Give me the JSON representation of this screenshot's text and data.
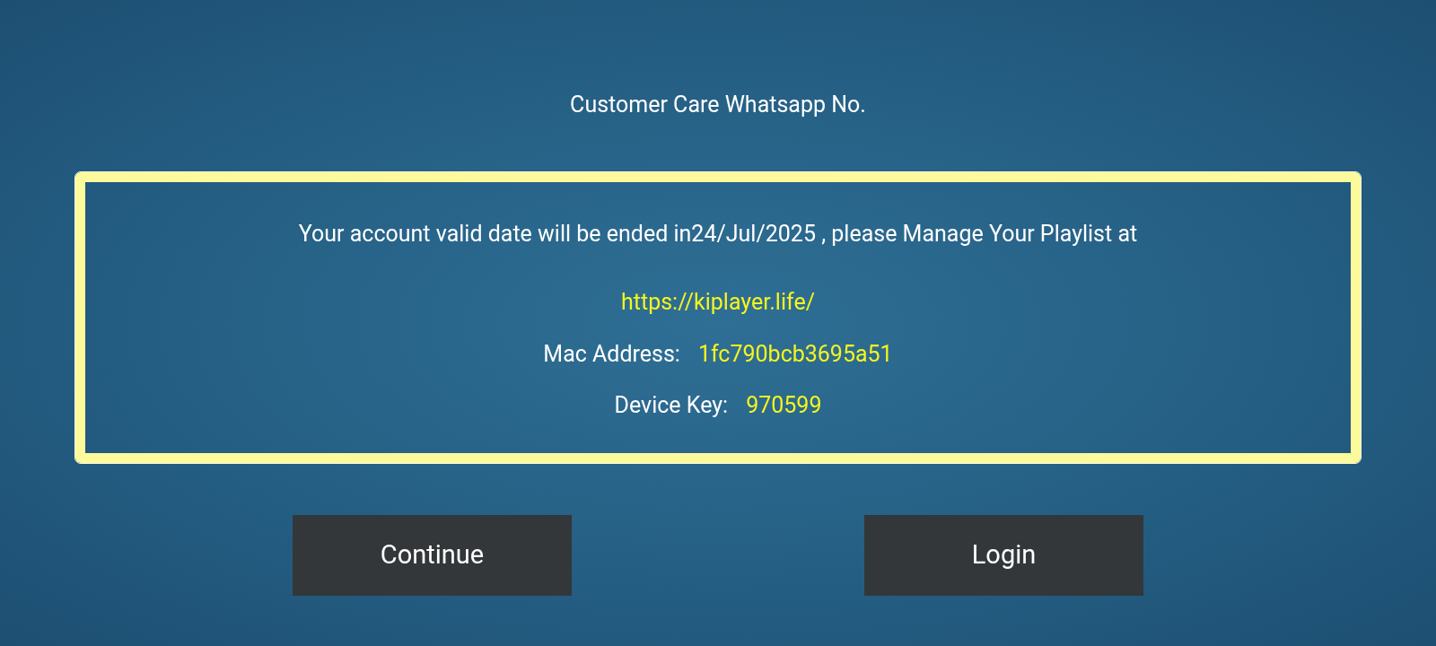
{
  "header": {
    "title": "Customer Care Whatsapp No."
  },
  "notice": {
    "message": "Your account valid date will be ended in24/Jul/2025 , please Manage Your Playlist at",
    "link": "https://kiplayer.life/",
    "fields": [
      {
        "label": "Mac Address:",
        "value": "1fc790bcb3695a51"
      },
      {
        "label": "Device Key:",
        "value": "970599"
      }
    ]
  },
  "buttons": [
    {
      "label": "Continue"
    },
    {
      "label": "Login"
    }
  ]
}
